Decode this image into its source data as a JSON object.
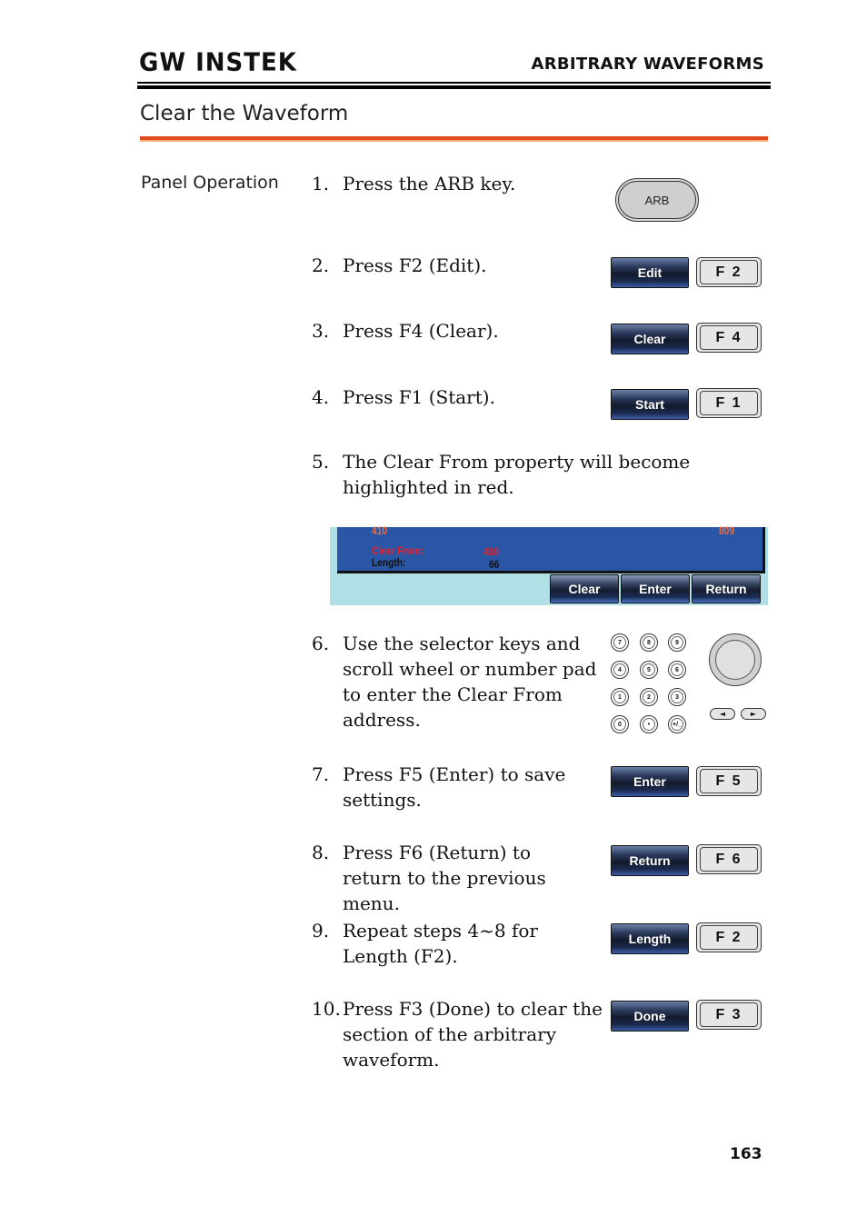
{
  "header": {
    "logo": "GW INSTEK",
    "section": "ARBITRARY WAVEFORMS"
  },
  "page_heading": "Clear the Waveform",
  "side_label": "Panel Operation",
  "steps": [
    {
      "num": "1.",
      "text": "Press the ARB key."
    },
    {
      "num": "2.",
      "text": "Press F2 (Edit)."
    },
    {
      "num": "3.",
      "text": "Press F4 (Clear)."
    },
    {
      "num": "4.",
      "text": "Press F1 (Start)."
    },
    {
      "num": "5.",
      "text": "The Clear From property will become highlighted in red."
    },
    {
      "num": "6.",
      "text": "Use the selector keys and scroll wheel or number pad to enter the Clear From address."
    },
    {
      "num": "7.",
      "text": "Press F5 (Enter) to save settings."
    },
    {
      "num": "8.",
      "text": "Press F6 (Return) to return to the previous menu."
    },
    {
      "num": "9.",
      "text": "Repeat steps 4~8 for Length (F2)."
    },
    {
      "num": "10.",
      "text": "Press F3 (Done) to clear the section of the arbitrary waveform."
    }
  ],
  "arb_key": "ARB",
  "key_pairs": [
    {
      "soft": "Edit",
      "fkey": "F 2"
    },
    {
      "soft": "Clear",
      "fkey": "F 4"
    },
    {
      "soft": "Start",
      "fkey": "F 1"
    },
    {
      "soft": "Enter",
      "fkey": "F 5"
    },
    {
      "soft": "Return",
      "fkey": "F 6"
    },
    {
      "soft": "Length",
      "fkey": "F 2"
    },
    {
      "soft": "Done",
      "fkey": "F 3"
    }
  ],
  "screen": {
    "start_value": "410",
    "end_value": "809",
    "clear_from_label": "Clear From:",
    "clear_from_value": "410",
    "length_label": "Length:",
    "length_value": "66",
    "buttons": [
      "Clear",
      "Enter",
      "Return"
    ],
    "colors": {
      "panel": "#2a56a6",
      "highlight": "#e8202a",
      "marker": "#f26b3a",
      "background": "#b0e0e6"
    }
  },
  "keypad": {
    "keys": [
      "7",
      "8",
      "9",
      "4",
      "5",
      "6",
      "1",
      "2",
      "3",
      "0",
      "•",
      "+/_"
    ],
    "arrows": [
      "◄",
      "►"
    ]
  },
  "page_number": "163",
  "accent_color": "#e14b1e"
}
